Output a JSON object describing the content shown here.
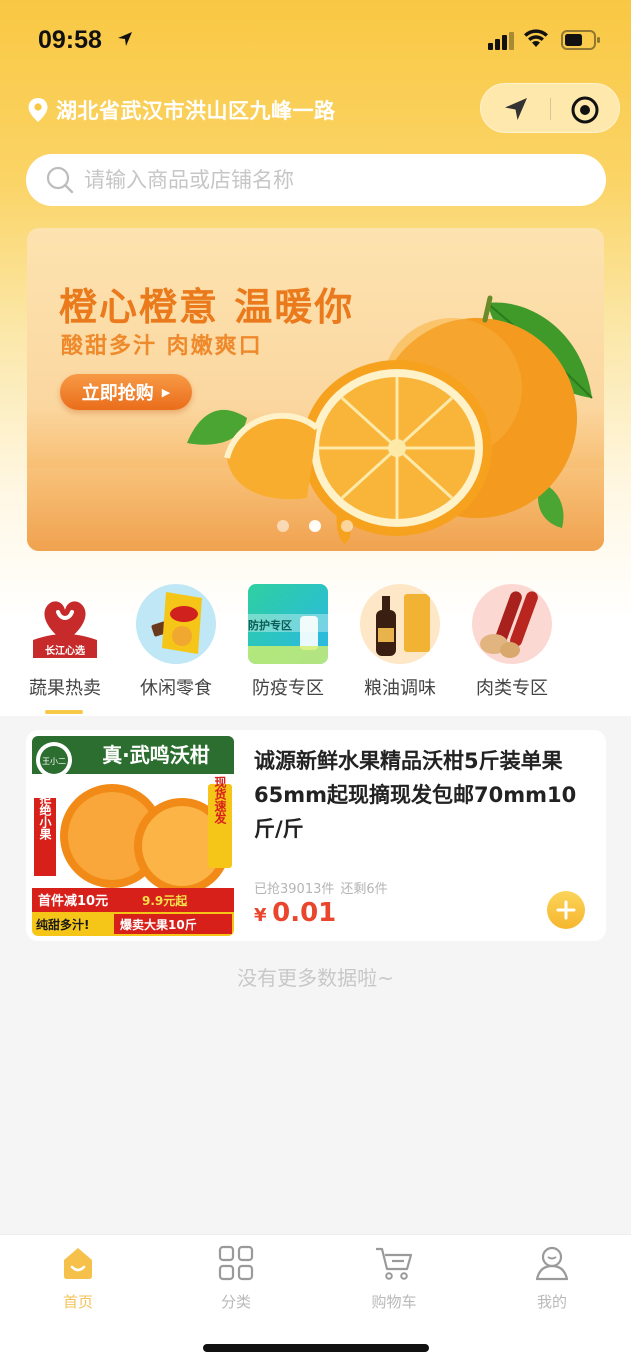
{
  "status_bar": {
    "time": "09:58"
  },
  "header": {
    "address": "湖北省武汉市洪山区九峰一路",
    "search": {
      "placeholder": "请输入商品或店铺名称",
      "value": ""
    }
  },
  "banner": {
    "title": "橙心橙意 温暖你",
    "subtitle": "酸甜多汁 肉嫩爽口",
    "button_label": "立即抢购",
    "dots": 3,
    "active_dot": 1
  },
  "categories": [
    {
      "label": "蔬果热卖",
      "icon": "changjiang-logo-icon",
      "logo_text": "长江心选"
    },
    {
      "label": "休闲零食",
      "icon": "snacks-icon"
    },
    {
      "label": "防疫专区",
      "icon": "epidemic-prevention-icon",
      "sign_text": "防护专区"
    },
    {
      "label": "粮油调味",
      "icon": "grain-oil-icon"
    },
    {
      "label": "肉类专区",
      "icon": "meat-icon"
    }
  ],
  "product": {
    "title": "诚源新鲜水果精品沃柑5斤装单果65mm起现摘现发包邮70mm10斤/斤",
    "sold": "已抢39013件",
    "remaining": "还剩6件",
    "currency": "¥",
    "price": "0.01",
    "image_texts": {
      "headline": "真·武鸣沃柑",
      "left_tag": "拒绝小果",
      "right_tag": "现货速发",
      "promo": "首件减10元",
      "promo_price": "9.9元起",
      "slogan_left": "纯甜多汁!",
      "slogan_right": "爆卖大果10斤",
      "mascot": "王小二"
    }
  },
  "footer_note": "没有更多数据啦~",
  "tabbar": [
    {
      "label": "首页",
      "icon": "home-icon",
      "active": true
    },
    {
      "label": "分类",
      "icon": "category-grid-icon",
      "active": false
    },
    {
      "label": "购物车",
      "icon": "cart-icon",
      "active": false
    },
    {
      "label": "我的",
      "icon": "profile-icon",
      "active": false
    }
  ],
  "colors": {
    "primary_yellow": "#f9c843",
    "price_red": "#e9462d",
    "banner_orange": "#ea7a1c"
  }
}
